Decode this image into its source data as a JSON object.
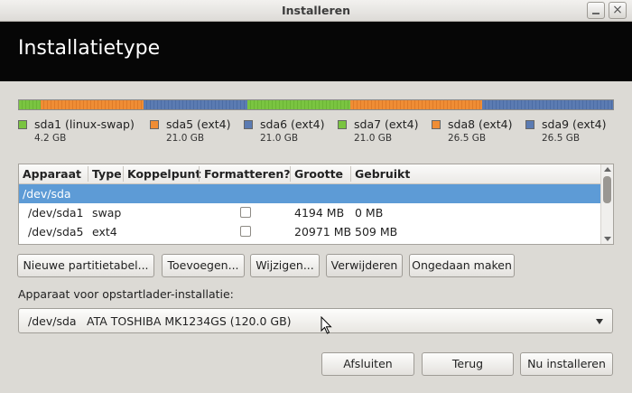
{
  "window": {
    "title": "Installeren"
  },
  "header": {
    "title": "Installatietype"
  },
  "partitions": [
    {
      "name": "sda1 (linux-swap)",
      "size": "4.2 GB",
      "color": "#7ac441"
    },
    {
      "name": "sda5 (ext4)",
      "size": "21.0 GB",
      "color": "#ef8d35"
    },
    {
      "name": "sda6 (ext4)",
      "size": "21.0 GB",
      "color": "#5b7bb2"
    },
    {
      "name": "sda7 (ext4)",
      "size": "21.0 GB",
      "color": "#7ac441"
    },
    {
      "name": "sda8 (ext4)",
      "size": "26.5 GB",
      "color": "#ef8d35"
    },
    {
      "name": "sda9 (ext4)",
      "size": "26.5 GB",
      "color": "#5b7bb2"
    }
  ],
  "table": {
    "columns": [
      "Apparaat",
      "Type",
      "Koppelpunt",
      "Formatteren?",
      "Grootte",
      "Gebruikt"
    ],
    "rows": [
      {
        "device": "/dev/sda",
        "type": "",
        "mount": "",
        "format": null,
        "size": "",
        "used": "",
        "selected": true
      },
      {
        "device": "/dev/sda1",
        "type": "swap",
        "mount": "",
        "format": false,
        "size": "4194 MB",
        "used": "0 MB",
        "selected": false
      },
      {
        "device": "/dev/sda5",
        "type": "ext4",
        "mount": "",
        "format": false,
        "size": "20971 MB",
        "used": "509 MB",
        "selected": false
      }
    ]
  },
  "actions": {
    "new_table": "Nieuwe partitietabel...",
    "add": "Toevoegen...",
    "change": "Wijzigen...",
    "delete": "Verwijderen",
    "undo": "Ongedaan maken"
  },
  "bootloader": {
    "label": "Apparaat voor opstartlader-installatie:",
    "device": "/dev/sda",
    "description": "ATA TOSHIBA MK1234GS (120.0 GB)"
  },
  "footer": {
    "quit": "Afsluiten",
    "back": "Terug",
    "install": "Nu installeren"
  }
}
